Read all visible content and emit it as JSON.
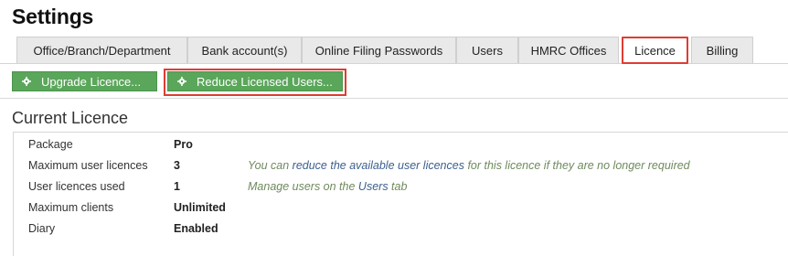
{
  "page": {
    "title": "Settings"
  },
  "tabs": [
    {
      "label": "Office/Branch/Department",
      "active": false
    },
    {
      "label": "Bank account(s)",
      "active": false
    },
    {
      "label": "Online Filing Passwords",
      "active": false
    },
    {
      "label": "Users",
      "active": false
    },
    {
      "label": "HMRC Offices",
      "active": false
    },
    {
      "label": "Licence",
      "active": true
    },
    {
      "label": "Billing",
      "active": false
    }
  ],
  "toolbar": {
    "upgrade_label": "Upgrade Licence...",
    "reduce_label": "Reduce Licensed Users..."
  },
  "section": {
    "title": "Current Licence"
  },
  "details": {
    "package": {
      "label": "Package",
      "value": "Pro"
    },
    "max_users": {
      "label": "Maximum user licences",
      "value": "3",
      "note_prefix": "You can ",
      "note_link": "reduce the available user licences",
      "note_suffix": " for this licence if they are no longer required"
    },
    "users_used": {
      "label": "User licences used",
      "value": "1",
      "note_prefix": "Manage users on the ",
      "note_link": "Users",
      "note_suffix": " tab"
    },
    "max_clients": {
      "label": "Maximum clients",
      "value": "Unlimited"
    },
    "diary": {
      "label": "Diary",
      "value": "Enabled"
    }
  },
  "colors": {
    "button_green": "#5aa65a",
    "highlight_red": "#e03c31",
    "note_green": "#6f8a5d",
    "link_blue": "#3d5f8e"
  },
  "icons": {
    "button_icon": "gear-icon"
  }
}
